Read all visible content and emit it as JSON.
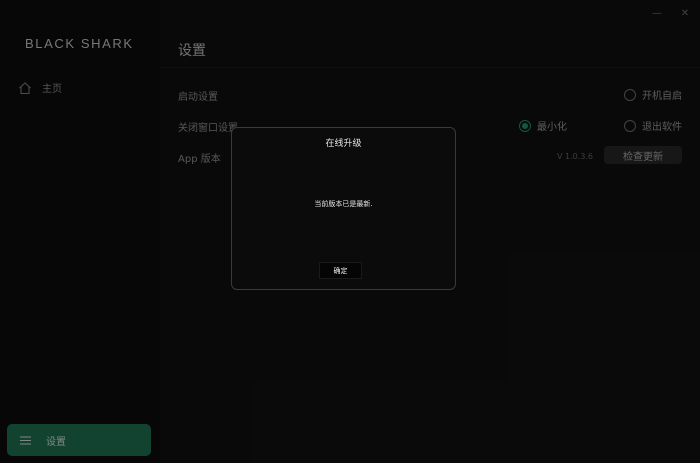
{
  "brand": {
    "name": "BLACK SHARK"
  },
  "sidebar": {
    "items": [
      {
        "label": "主页",
        "icon": "home-icon"
      },
      {
        "label": "设置",
        "icon": "menu-icon",
        "active": true
      }
    ]
  },
  "window": {
    "minimize_glyph": "—",
    "close_glyph": "✕"
  },
  "main": {
    "title": "设置",
    "startup": {
      "label": "启动设置",
      "option_label": "开机自启",
      "option_checked": false
    },
    "close_window": {
      "label": "关闭窗口设置",
      "options": [
        {
          "label": "最小化",
          "checked": true
        },
        {
          "label": "退出软件",
          "checked": false
        }
      ]
    },
    "app_version": {
      "label": "App 版本",
      "value": "V 1.0.3.6",
      "check_button": "检查更新"
    }
  },
  "dialog": {
    "title": "在线升级",
    "message": "当前版本已是最新.",
    "ok_label": "确定"
  },
  "colors": {
    "accent": "#1f7a58",
    "radio_active": "#27a070",
    "background": "#121212",
    "sidebar_bg": "#0d0d0d"
  }
}
